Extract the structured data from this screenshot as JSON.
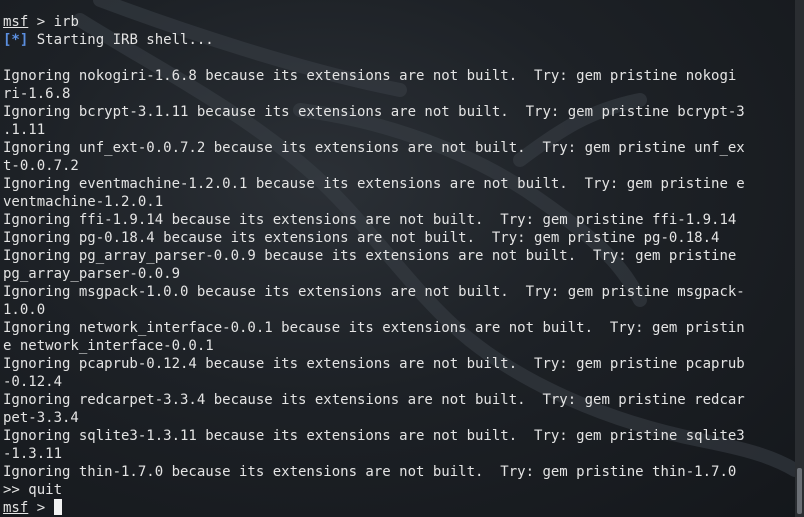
{
  "terminal": {
    "prompt_name": "msf",
    "prompt_suffix": " > ",
    "command": "irb",
    "status_marker": "[*]",
    "status_text": " Starting IRB shell...",
    "output_lines": [
      "Ignoring nokogiri-1.6.8 because its extensions are not built.  Try: gem pristine nokogi",
      "ri-1.6.8",
      "Ignoring bcrypt-3.1.11 because its extensions are not built.  Try: gem pristine bcrypt-3",
      ".1.11",
      "Ignoring unf_ext-0.0.7.2 because its extensions are not built.  Try: gem pristine unf_ex",
      "t-0.0.7.2",
      "Ignoring eventmachine-1.2.0.1 because its extensions are not built.  Try: gem pristine e",
      "ventmachine-1.2.0.1",
      "Ignoring ffi-1.9.14 because its extensions are not built.  Try: gem pristine ffi-1.9.14",
      "Ignoring pg-0.18.4 because its extensions are not built.  Try: gem pristine pg-0.18.4",
      "Ignoring pg_array_parser-0.0.9 because its extensions are not built.  Try: gem pristine",
      "pg_array_parser-0.0.9",
      "Ignoring msgpack-1.0.0 because its extensions are not built.  Try: gem pristine msgpack-",
      "1.0.0",
      "Ignoring network_interface-0.0.1 because its extensions are not built.  Try: gem pristin",
      "e network_interface-0.0.1",
      "Ignoring pcaprub-0.12.4 because its extensions are not built.  Try: gem pristine pcaprub",
      "-0.12.4",
      "Ignoring redcarpet-3.3.4 because its extensions are not built.  Try: gem pristine redcar",
      "pet-3.3.4",
      "Ignoring sqlite3-1.3.11 because its extensions are not built.  Try: gem pristine sqlite3",
      "-1.3.11",
      "Ignoring thin-1.7.0 because its extensions are not built.  Try: gem pristine thin-1.7.0"
    ],
    "irb_prompt": ">> ",
    "irb_command": "quit",
    "final_prompt_suffix": " > "
  },
  "colors": {
    "status_marker": "#5b8fe0",
    "text": "#e4e4e4",
    "background": "#1d2126"
  },
  "icons": {
    "watermark": "kali-dragon-icon"
  }
}
